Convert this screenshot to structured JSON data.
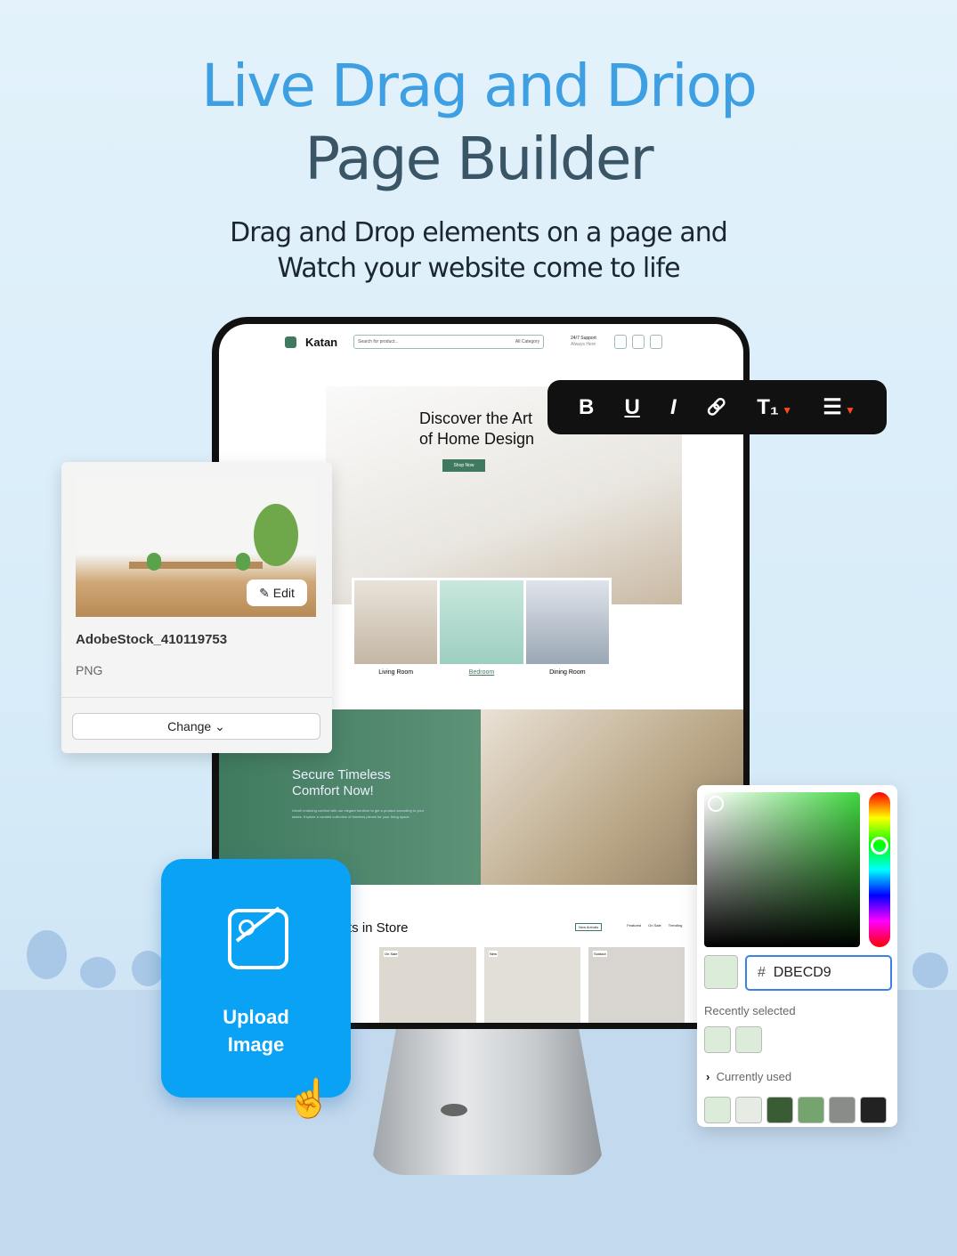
{
  "hero": {
    "title_line1": "Live Drag and Driop",
    "title_line2": "Page Builder",
    "subtitle_line1": "Drag and Drop elements on a page and",
    "subtitle_line2": "Watch your website come to life"
  },
  "site": {
    "logo": "Katan",
    "search_placeholder": "Search for product...",
    "category": "All Category",
    "support_title": "24/7 Support",
    "support_sub": "Always Here",
    "hero_heading_1": "Discover the Art",
    "hero_heading_2": "of Home Design",
    "shop_now": "Shop Now",
    "rooms": [
      "Living Room",
      "Bedroom",
      "Dining Room"
    ],
    "banner_title_1": "Secure Timeless",
    "banner_title_2": "Comfort Now!",
    "banner_text": "Unveil enduring comfort with our elegant furniture to get a product according to your tastes. Explore a curated collection of timeless pieces for your living space.",
    "products_title": "ts in Store",
    "product_tabs": [
      "New Arrivals",
      "Featured",
      "On Sale",
      "Trending"
    ],
    "product_badges": [
      "On Sale",
      "New",
      "Soldout"
    ]
  },
  "toolbar": {
    "items": [
      {
        "icon": "bold-icon",
        "label": "B"
      },
      {
        "icon": "underline-icon",
        "label": "U"
      },
      {
        "icon": "italic-icon",
        "label": "I"
      },
      {
        "icon": "link-icon",
        "label": "🔗"
      },
      {
        "icon": "text-size-icon",
        "label": "T₁"
      },
      {
        "icon": "list-icon",
        "label": "☰"
      }
    ],
    "accent": "#ff4a1a"
  },
  "image_card": {
    "edit_label": "Edit",
    "filename": "AdobeStock_410119753",
    "filetype": "PNG",
    "change_label": "Change"
  },
  "upload": {
    "label_1": "Upload",
    "label_2": "Image",
    "color": "#09a2f5"
  },
  "color_picker": {
    "hash": "#",
    "hex_value": "DBECD9",
    "recently_selected_label": "Recently selected",
    "recently_selected": [
      "#dbecd9",
      "#dbecd9"
    ],
    "currently_used_label": "Currently used",
    "currently_used": [
      "#dbecd9",
      "#e6ebe4",
      "#3a5c35",
      "#74a56f",
      "#8a8c8a",
      "#222222"
    ]
  }
}
